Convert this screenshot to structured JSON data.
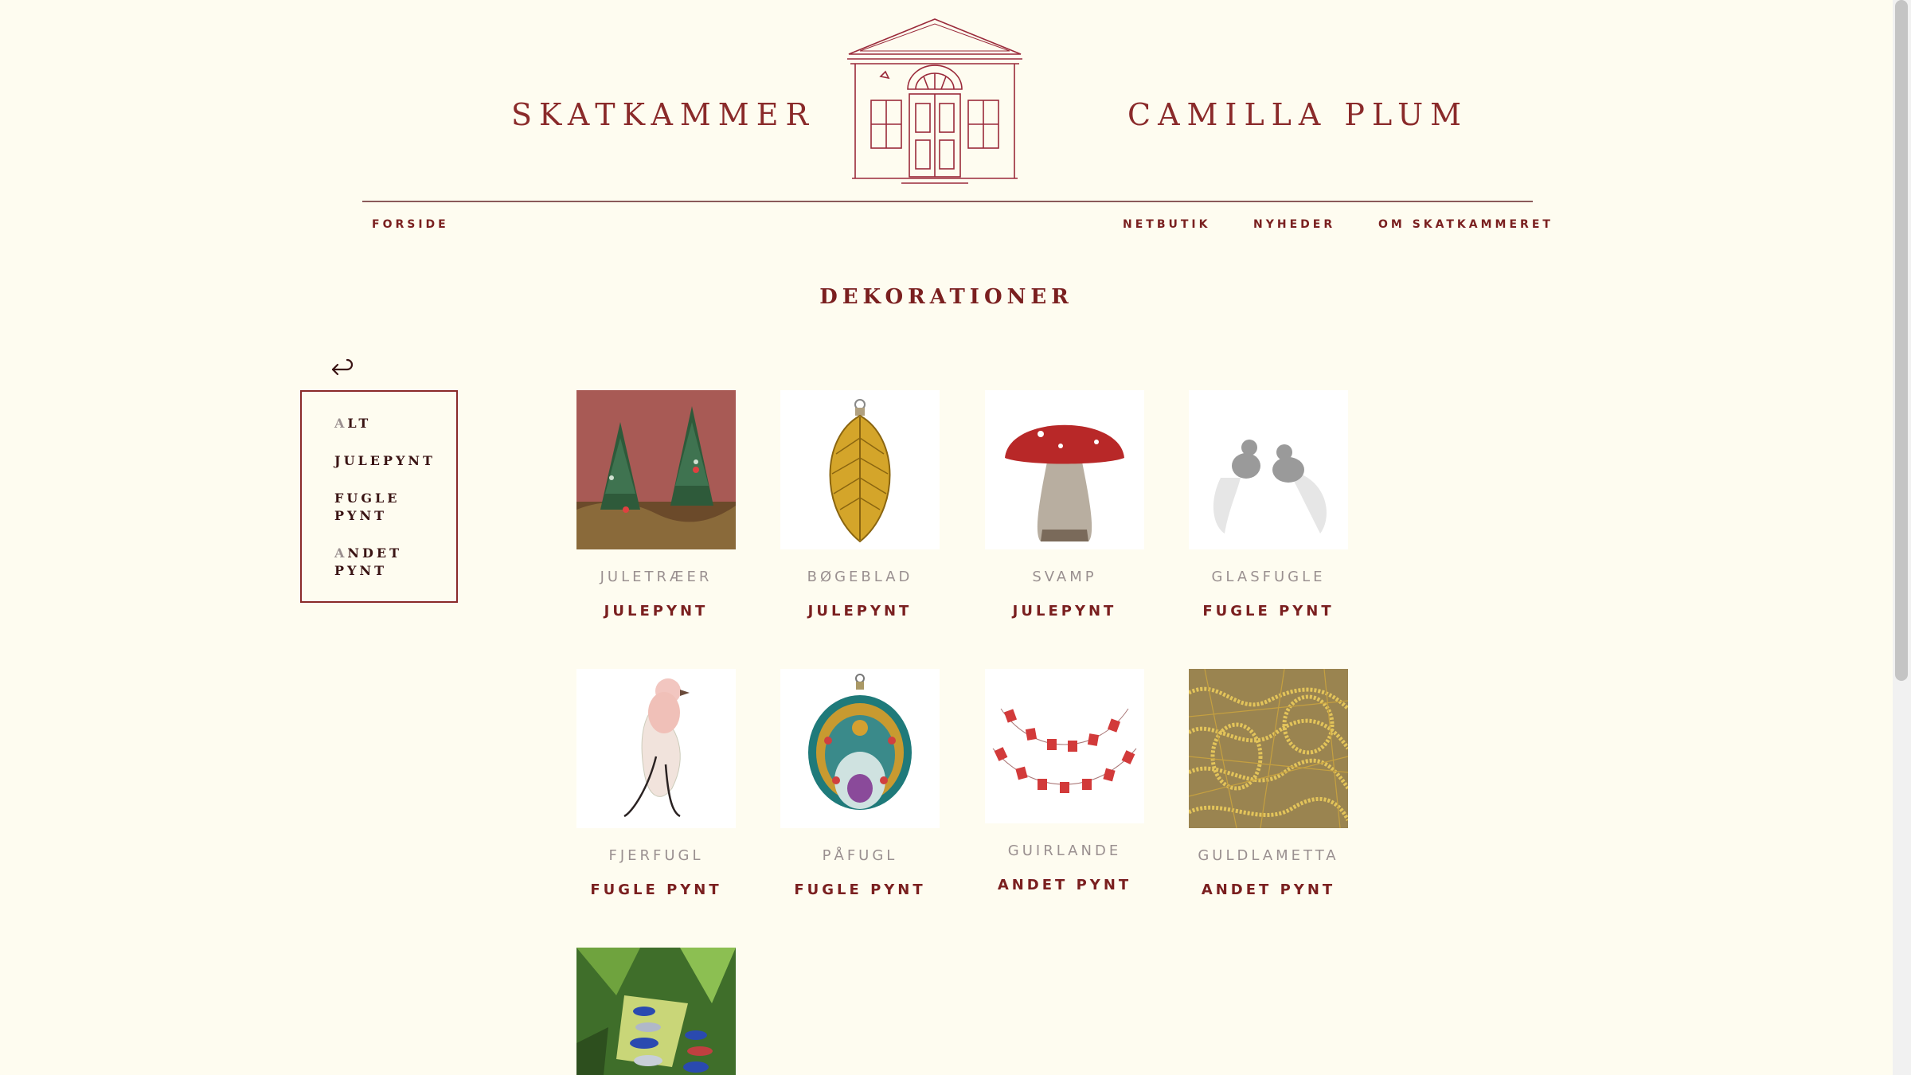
{
  "header": {
    "brand_left": "SKATKAMMER",
    "brand_right": "CAMILLA PLUM",
    "logo_icon": "house-icon"
  },
  "nav": {
    "items": [
      {
        "label": "FORSIDE"
      },
      {
        "label": "NETBUTIK"
      },
      {
        "label": "NYHEDER"
      },
      {
        "label": "OM SKATKAMMERET"
      }
    ]
  },
  "page": {
    "heading": "DEKORATIONER"
  },
  "filters": {
    "back_icon": "back-arrow-icon",
    "items": [
      {
        "cap": "A",
        "rest": "LT"
      },
      {
        "cap": "",
        "rest": "JULEPYNT"
      },
      {
        "cap": "",
        "rest": "FUGLE PYNT"
      },
      {
        "cap": "A",
        "rest": "NDET PYNT"
      }
    ]
  },
  "products": [
    {
      "name": "JULETRÆER",
      "category": "JULEPYNT"
    },
    {
      "name": "BØGEBLAD",
      "category": "JULEPYNT"
    },
    {
      "name": "SVAMP",
      "category": "JULEPYNT"
    },
    {
      "name": "GLASFUGLE",
      "category": "FUGLE PYNT"
    },
    {
      "name": "FJERFUGL",
      "category": "FUGLE PYNT"
    },
    {
      "name": "PÅFUGL",
      "category": "FUGLE PYNT"
    },
    {
      "name": "GUIRLANDE",
      "category": "ANDET PYNT"
    },
    {
      "name": "GULDLAMETTA",
      "category": "ANDET PYNT"
    }
  ],
  "colors": {
    "background": "#fefcf0",
    "brand": "#8a2a2a",
    "heading": "#7a1f1f",
    "muted": "#9a9090"
  }
}
